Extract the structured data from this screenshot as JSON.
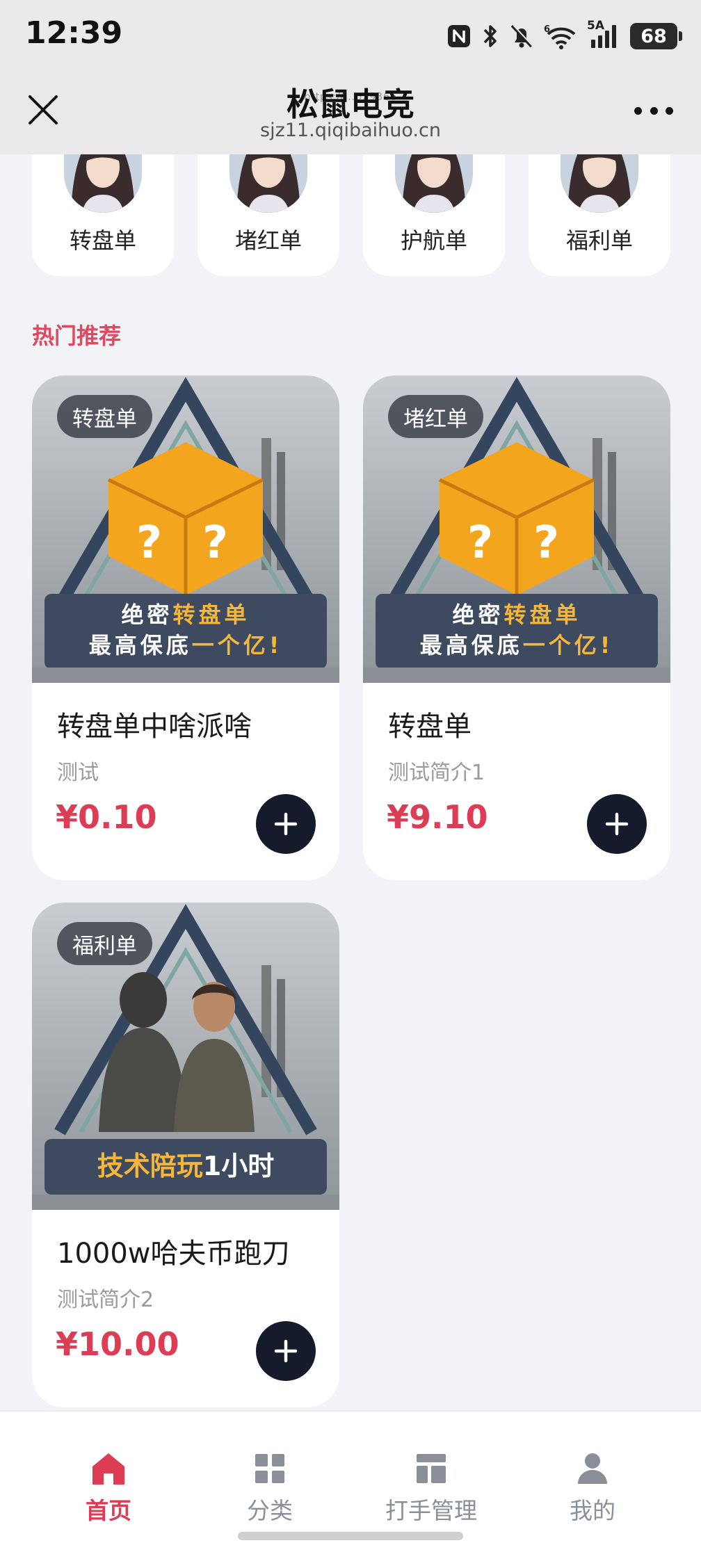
{
  "status_bar": {
    "time": "12:39",
    "network": "5A",
    "battery": "68",
    "icons": [
      "nfc-icon",
      "bluetooth-icon",
      "mute-icon",
      "wifi-icon",
      "signal-icon",
      "battery-icon"
    ]
  },
  "title_bar": {
    "title": "松鼠电竞",
    "watermark": "https://...p29366",
    "domain": "sjz11.qiqibaihuo.cn"
  },
  "categories": [
    {
      "label": "转盘单"
    },
    {
      "label": "堵红单"
    },
    {
      "label": "护航单"
    },
    {
      "label": "福利单"
    }
  ],
  "section_title": "热门推荐",
  "products": [
    {
      "tag": "转盘单",
      "banner_line1_a": "绝密",
      "banner_line1_b": "转盘单",
      "banner_line2_a": "最高保底",
      "banner_line2_b": "一个亿!",
      "name": "转盘单中啥派啥",
      "desc": "测试",
      "price": "¥0.10"
    },
    {
      "tag": "堵红单",
      "banner_line1_a": "绝密",
      "banner_line1_b": "转盘单",
      "banner_line2_a": "最高保底",
      "banner_line2_b": "一个亿!",
      "name": "转盘单",
      "desc": "测试简介1",
      "price": "¥9.10"
    },
    {
      "tag": "福利单",
      "banner_line1_a": "技术陪玩",
      "banner_line1_b": "1小时",
      "name": "1000w哈夫币跑刀",
      "desc": "测试简介2",
      "price": "¥10.00"
    }
  ],
  "bottom_nav": [
    {
      "label": "首页",
      "icon": "home-icon",
      "active": true
    },
    {
      "label": "分类",
      "icon": "grid-icon",
      "active": false
    },
    {
      "label": "打手管理",
      "icon": "layout-icon",
      "active": false
    },
    {
      "label": "我的",
      "icon": "user-icon",
      "active": false
    }
  ],
  "colors": {
    "accent": "#dc3d55",
    "add_button": "#151b2b",
    "background": "#f1f3f7",
    "banner_highlight": "#f5b63a"
  }
}
